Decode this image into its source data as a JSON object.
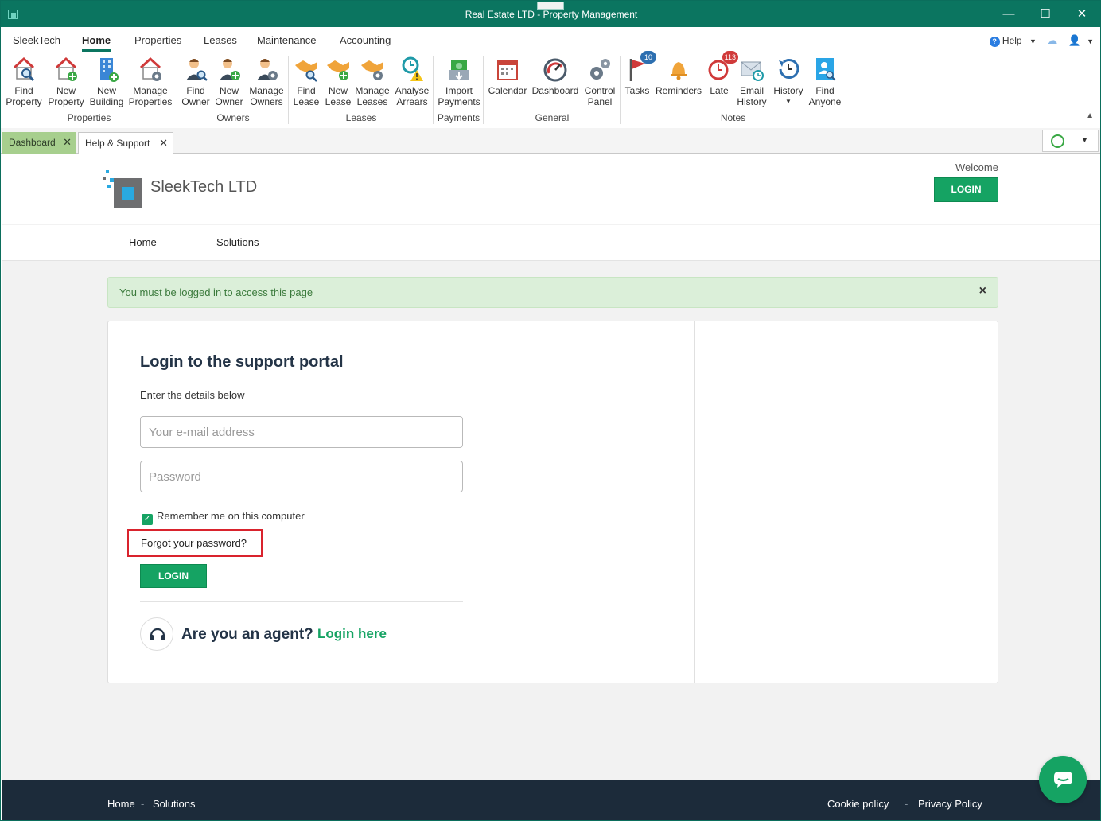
{
  "window": {
    "title": "Real Estate LTD - Property Management",
    "minimize": "—",
    "maximize": "☐",
    "close": "✕"
  },
  "menu": {
    "tabs": [
      "SleekTech",
      "Home",
      "Properties",
      "Leases",
      "Maintenance",
      "Accounting"
    ],
    "active": "Home",
    "help": "Help"
  },
  "ribbon": {
    "buttons": {
      "find_property": "Find Property",
      "new_property": "New Property",
      "new_building": "New Building",
      "manage_properties": "Manage Properties",
      "find_owner": "Find Owner",
      "new_owner": "New Owner",
      "manage_owners": "Manage Owners",
      "find_lease": "Find Lease",
      "new_lease": "New Lease",
      "manage_leases": "Manage Leases",
      "analyse_arrears": "Analyse Arrears",
      "import_payments": "Import Payments",
      "calendar": "Calendar",
      "dashboard": "Dashboard",
      "control_panel": "Control Panel",
      "tasks": "Tasks",
      "reminders": "Reminders",
      "late": "Late",
      "email_history": "Email History",
      "history": "History",
      "find_anyone": "Find Anyone"
    },
    "badges": {
      "tasks": "10",
      "late": "113"
    },
    "groups": {
      "properties": "Properties",
      "owners": "Owners",
      "leases": "Leases",
      "payments": "Payments",
      "general": "General",
      "notes": "Notes"
    }
  },
  "doc_tabs": [
    {
      "label": "Dashboard",
      "close": "✕"
    },
    {
      "label": "Help & Support",
      "close": "✕"
    }
  ],
  "site": {
    "brand": "SleekTech LTD",
    "welcome": "Welcome",
    "header_login": "LOGIN",
    "nav": [
      "Home",
      "Solutions"
    ]
  },
  "alert": {
    "message": "You must be logged in to access this page",
    "close": "×"
  },
  "login": {
    "title": "Login to the support portal",
    "subtitle": "Enter the details below",
    "email_placeholder": "Your e-mail address",
    "password_placeholder": "Password",
    "remember": "Remember me on this computer",
    "forgot": "Forgot your password?",
    "submit": "LOGIN",
    "agent_question": "Are you an agent?",
    "agent_link": "Login here"
  },
  "footer": {
    "left": [
      "Home",
      "Solutions"
    ],
    "right": [
      "Cookie policy",
      "Privacy Policy"
    ],
    "sep": "-"
  },
  "colors": {
    "titlebar": "#0b7560",
    "accent_green": "#15a363",
    "footer": "#1c2b3a",
    "alert_bg": "#dbefd9",
    "highlight_red": "#d9232d"
  }
}
